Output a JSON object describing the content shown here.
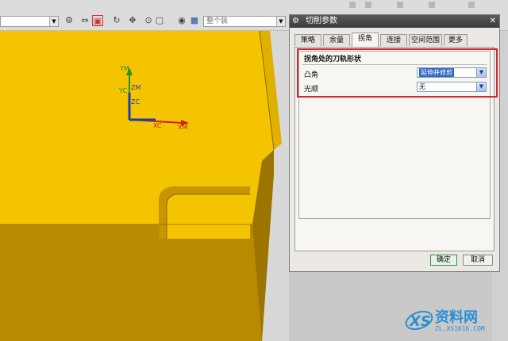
{
  "toolbar": {
    "view_combo_value": "",
    "search_combo_value": "整个装"
  },
  "viewport": {
    "axes": {
      "ym": "YM",
      "zm": "ZM",
      "yc": "YC",
      "zc": "ZC",
      "xc": "XC",
      "xm": "XM"
    }
  },
  "dialog": {
    "title": "切削参数",
    "tabs": [
      "策略",
      "余量",
      "拐角",
      "连接",
      "空间范围",
      "更多"
    ],
    "active_tab": "拐角",
    "group_title": "拐角处的刀轨形状",
    "rows": [
      {
        "label": "凸角",
        "value": "延伸并修剪"
      },
      {
        "label": "光顺",
        "value": "无"
      }
    ],
    "ok_label": "确定",
    "cancel_label": "取消"
  },
  "watermark": {
    "name": "资料网",
    "url": "ZL.XS1616.COM"
  },
  "colors": {
    "part_top": "#f5c400",
    "part_side": "#b88a00",
    "highlight": "#d8242c",
    "selected": "#316ac5"
  }
}
